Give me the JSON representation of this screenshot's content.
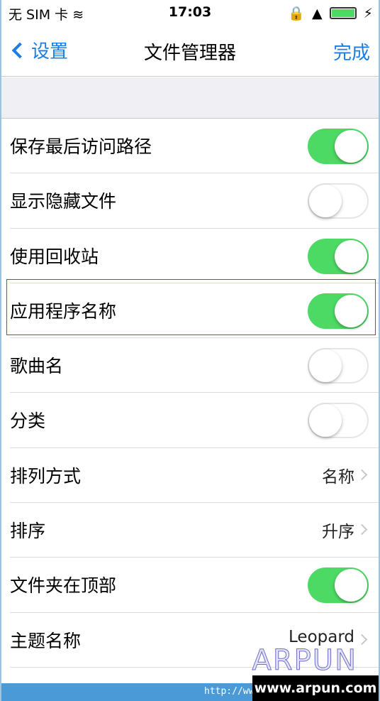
{
  "status": {
    "carrier": "无 SIM 卡",
    "time": "17:03",
    "icons": [
      "wifi-icon",
      "rotation-lock-icon",
      "airplay-icon",
      "battery-icon",
      "charging-icon"
    ]
  },
  "nav": {
    "back_label": "设置",
    "title": "文件管理器",
    "done_label": "完成"
  },
  "rows": [
    {
      "label": "保存最后访问路径",
      "type": "toggle",
      "on": true
    },
    {
      "label": "显示隐藏文件",
      "type": "toggle",
      "on": false
    },
    {
      "label": "使用回收站",
      "type": "toggle",
      "on": true
    },
    {
      "label": "应用程序名称",
      "type": "toggle",
      "on": true
    },
    {
      "label": "歌曲名",
      "type": "toggle",
      "on": false
    },
    {
      "label": "分类",
      "type": "toggle",
      "on": false
    },
    {
      "label": "排列方式",
      "type": "value",
      "value": "名称"
    },
    {
      "label": "排序",
      "type": "value",
      "value": "升序"
    },
    {
      "label": "文件夹在顶部",
      "type": "toggle",
      "on": true
    },
    {
      "label": "主题名称",
      "type": "value",
      "value": "Leopard"
    }
  ],
  "watermark": "ARPUN",
  "footer": {
    "url": "http://ww",
    "brand": "www.arpun.com"
  },
  "colors": {
    "accent": "#1a7ee6",
    "toggle_on": "#4cd964",
    "highlight": "#c0392b"
  }
}
